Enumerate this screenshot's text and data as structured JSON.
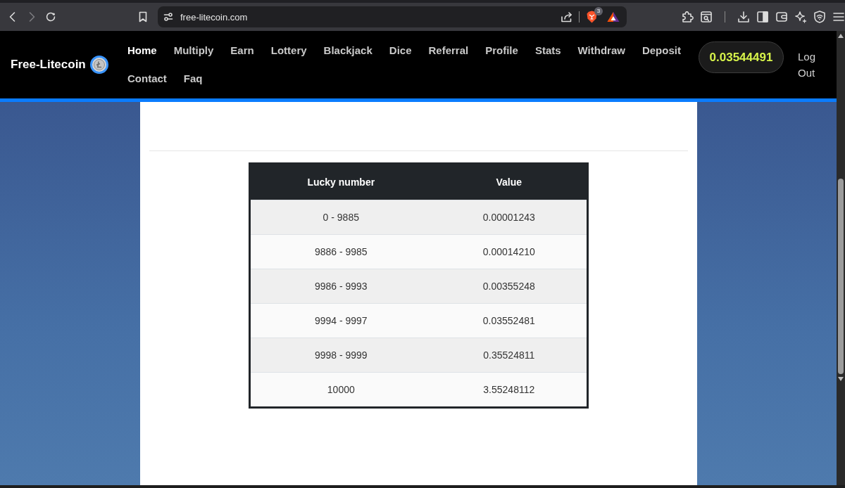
{
  "browser": {
    "url": "free-litecoin.com",
    "shields_count": "3"
  },
  "header": {
    "logo": "Free-Litecoin",
    "nav": [
      {
        "label": "Home",
        "selected": true
      },
      {
        "label": "Multiply",
        "selected": false
      },
      {
        "label": "Earn",
        "selected": false
      },
      {
        "label": "Lottery",
        "selected": false
      },
      {
        "label": "Blackjack",
        "selected": false
      },
      {
        "label": "Dice",
        "selected": false
      },
      {
        "label": "Referral",
        "selected": false
      },
      {
        "label": "Profile",
        "selected": false
      },
      {
        "label": "Stats",
        "selected": false
      },
      {
        "label": "Withdraw",
        "selected": false
      },
      {
        "label": "Deposit",
        "selected": false
      },
      {
        "label": "Contact",
        "selected": false
      },
      {
        "label": "Faq",
        "selected": false
      }
    ],
    "balance": "0.03544491",
    "logout": "Log Out"
  },
  "table": {
    "columns": [
      "Lucky number",
      "Value"
    ],
    "rows": [
      [
        "0 - 9885",
        "0.00001243"
      ],
      [
        "9886 - 9985",
        "0.00014210"
      ],
      [
        "9986 - 9993",
        "0.00355248"
      ],
      [
        "9994 - 9997",
        "0.03552481"
      ],
      [
        "9998 - 9999",
        "0.35524811"
      ],
      [
        "10000",
        "3.55248112"
      ]
    ]
  }
}
